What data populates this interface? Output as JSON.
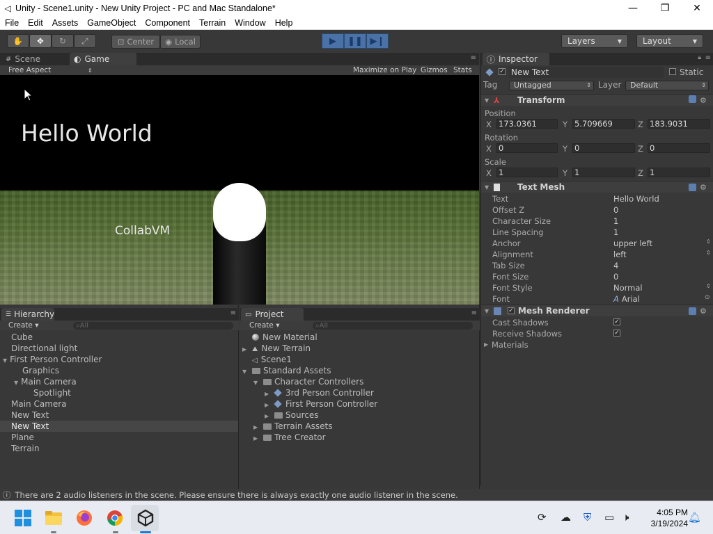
{
  "window": {
    "title": "Unity - Scene1.unity - New Unity Project - PC and Mac Standalone*",
    "minimize": "—",
    "maximize": "❐",
    "close": "✕"
  },
  "menu": [
    "File",
    "Edit",
    "Assets",
    "GameObject",
    "Component",
    "Terrain",
    "Window",
    "Help"
  ],
  "toolbar": {
    "center": "Center",
    "local": "Local",
    "layers": "Layers",
    "layout": "Layout"
  },
  "scene_panel": {
    "tab_scene": "Scene",
    "tab_game": "Game",
    "aspect": "Free Aspect",
    "maximize": "Maximize on Play",
    "gizmos": "Gizmos",
    "stats": "Stats"
  },
  "game": {
    "hello_text": "Hello World",
    "collab_text": "CollabVM"
  },
  "hierarchy": {
    "title": "Hierarchy",
    "create": "Create ▾",
    "search": "All",
    "items": [
      {
        "label": "Cube",
        "indent": 0,
        "tri": ""
      },
      {
        "label": "Directional light",
        "indent": 0,
        "tri": ""
      },
      {
        "label": "First Person Controller",
        "indent": 0,
        "tri": "▼"
      },
      {
        "label": "Graphics",
        "indent": 1,
        "tri": ""
      },
      {
        "label": "Main Camera",
        "indent": 1,
        "tri": "▼"
      },
      {
        "label": "Spotlight",
        "indent": 2,
        "tri": ""
      },
      {
        "label": "Main Camera",
        "indent": 0,
        "tri": ""
      },
      {
        "label": "New Text",
        "indent": 0,
        "tri": ""
      },
      {
        "label": "New Text",
        "indent": 0,
        "tri": "",
        "selected": true
      },
      {
        "label": "Plane",
        "indent": 0,
        "tri": ""
      },
      {
        "label": "Terrain",
        "indent": 0,
        "tri": ""
      }
    ]
  },
  "project": {
    "title": "Project",
    "create": "Create ▾",
    "search": "All",
    "items": [
      {
        "label": "New Material",
        "indent": 0,
        "tri": "",
        "icon": "sphere"
      },
      {
        "label": "New Terrain",
        "indent": 0,
        "tri": "▶",
        "icon": "terrain"
      },
      {
        "label": "Scene1",
        "indent": 0,
        "tri": "",
        "icon": "unity"
      },
      {
        "label": "Standard Assets",
        "indent": 0,
        "tri": "▼",
        "icon": "folder"
      },
      {
        "label": "Character Controllers",
        "indent": 1,
        "tri": "▼",
        "icon": "folder"
      },
      {
        "label": "3rd Person Controller",
        "indent": 2,
        "tri": "▶",
        "icon": "cube"
      },
      {
        "label": "First Person Controller",
        "indent": 2,
        "tri": "▶",
        "icon": "cube"
      },
      {
        "label": "Sources",
        "indent": 2,
        "tri": "▶",
        "icon": "folder"
      },
      {
        "label": "Terrain Assets",
        "indent": 1,
        "tri": "▶",
        "icon": "folder"
      },
      {
        "label": "Tree Creator",
        "indent": 1,
        "tri": "▶",
        "icon": "folder"
      }
    ]
  },
  "inspector": {
    "title": "Inspector",
    "object_name": "New Text",
    "static": "Static",
    "tag_label": "Tag",
    "tag_value": "Untagged",
    "layer_label": "Layer",
    "layer_value": "Default",
    "transform": {
      "title": "Transform",
      "position_label": "Position",
      "rotation_label": "Rotation",
      "scale_label": "Scale",
      "x": "X",
      "y": "Y",
      "z": "Z",
      "position": [
        "173.0361",
        "5.709669",
        "183.9031"
      ],
      "rotation": [
        "0",
        "0",
        "0"
      ],
      "scale": [
        "1",
        "1",
        "1"
      ]
    },
    "text_mesh": {
      "title": "Text Mesh",
      "props": [
        {
          "label": "Text",
          "value": "Hello World"
        },
        {
          "label": "Offset Z",
          "value": "0"
        },
        {
          "label": "Character Size",
          "value": "1"
        },
        {
          "label": "Line Spacing",
          "value": "1"
        },
        {
          "label": "Anchor",
          "value": "upper left"
        },
        {
          "label": "Alignment",
          "value": "left"
        },
        {
          "label": "Tab Size",
          "value": "4"
        },
        {
          "label": "Font Size",
          "value": "0"
        },
        {
          "label": "Font Style",
          "value": "Normal"
        },
        {
          "label": "Font",
          "value": "Arial"
        }
      ]
    },
    "mesh_renderer": {
      "title": "Mesh Renderer",
      "cast": "Cast Shadows",
      "receive": "Receive Shadows",
      "materials": "Materials"
    }
  },
  "console": {
    "message": "There are 2 audio listeners in the scene. Please ensure there is always exactly one audio listener in the scene."
  },
  "taskbar": {
    "time": "4:05 PM",
    "date": "3/19/2024"
  }
}
